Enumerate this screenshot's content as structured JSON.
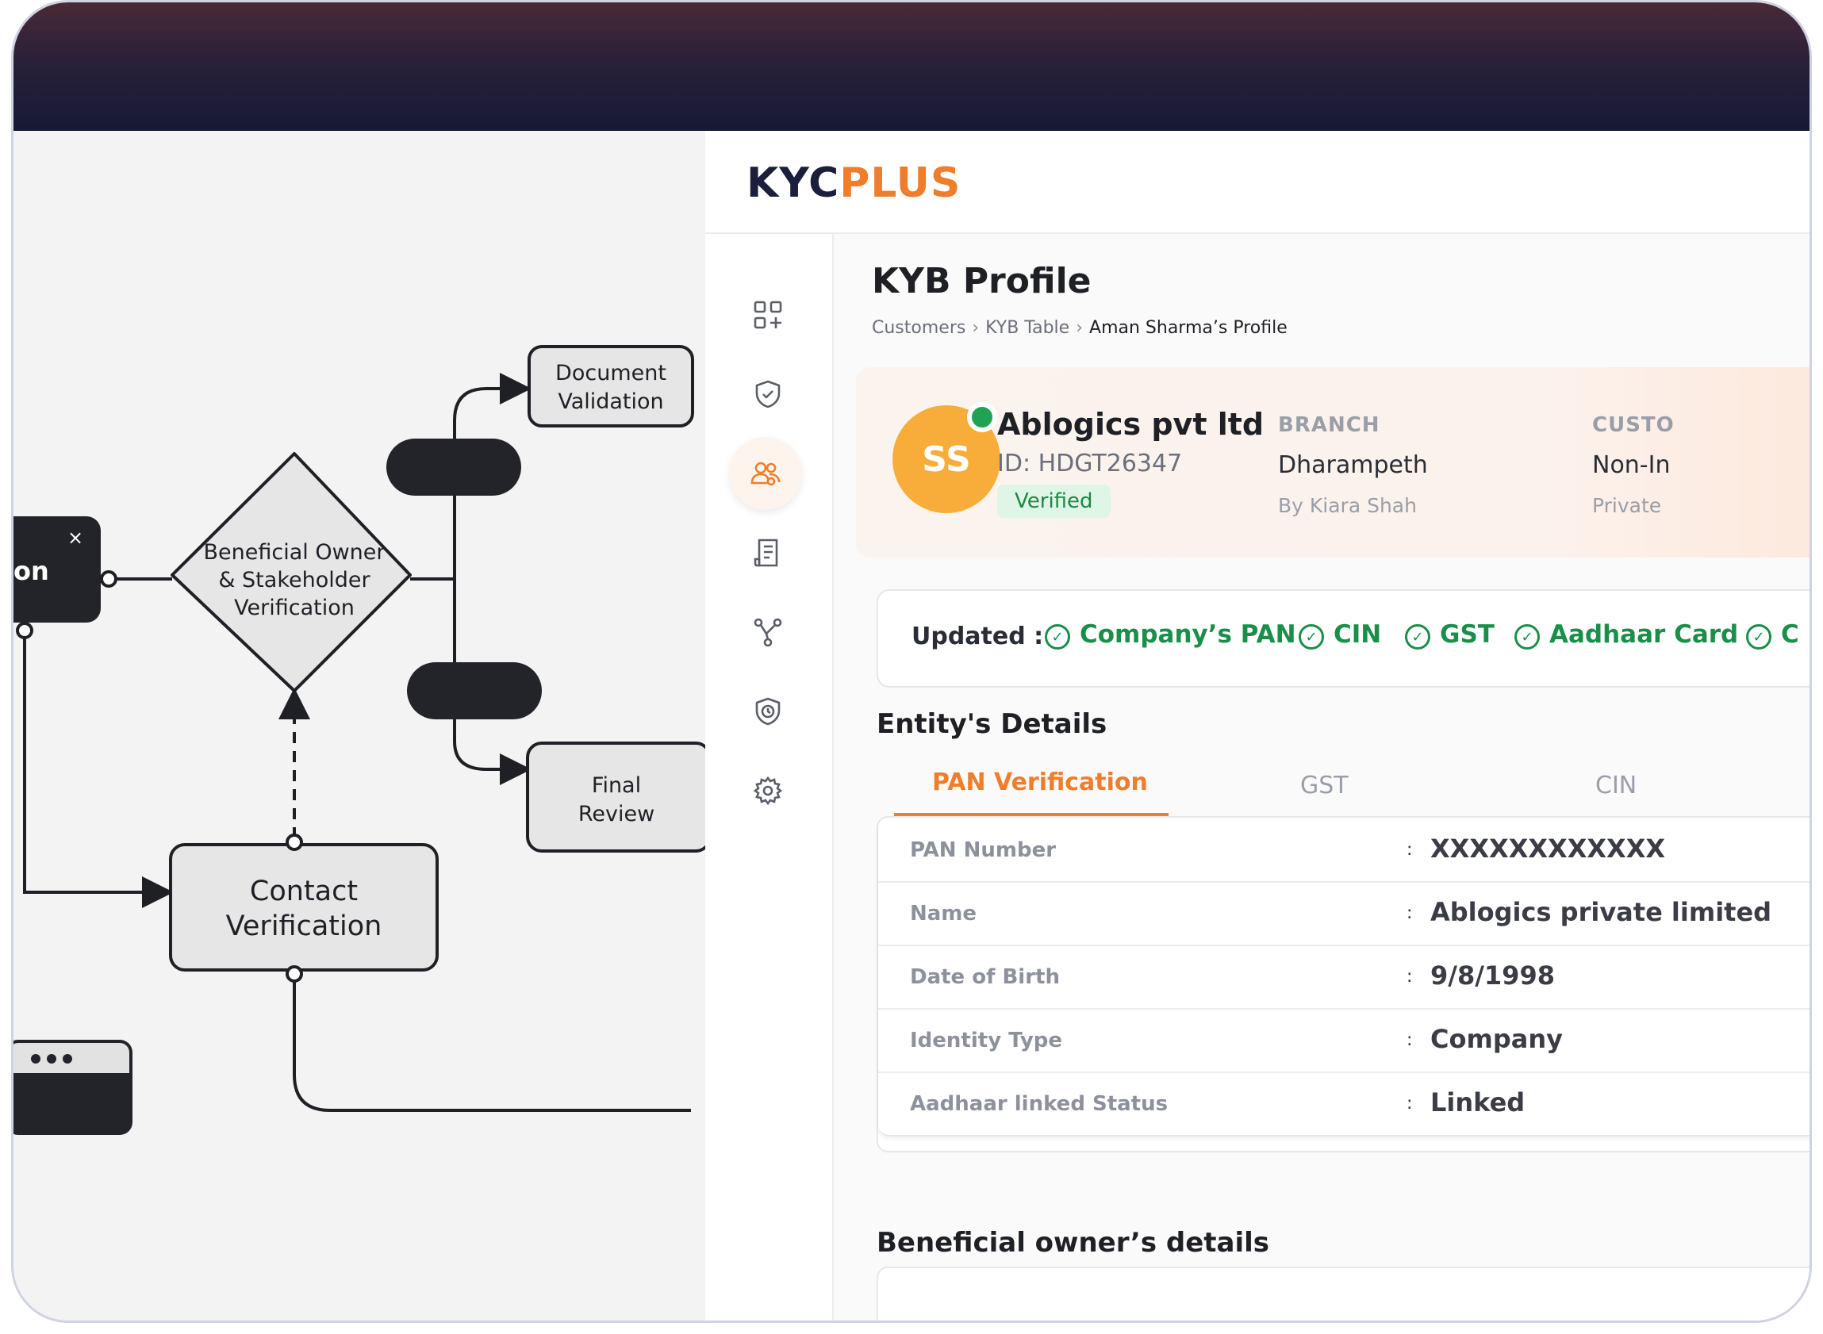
{
  "flowchart": {
    "nodes": {
      "document_validation": [
        "Document",
        "Validation"
      ],
      "beneficial_owner": [
        "Beneficial Owner",
        "& Stakeholder",
        "Verification"
      ],
      "final_review": [
        "Final",
        "Review"
      ],
      "contact_verification": [
        "Contact",
        "Verification"
      ],
      "partial_node": "on",
      "close_glyph": "×"
    }
  },
  "app": {
    "logo": {
      "part1": "KYC",
      "part2": "PLUS",
      "plus_color": "#f07d2c"
    },
    "sidebar": {
      "items": [
        {
          "icon": "dashboard-add-icon"
        },
        {
          "icon": "shield-check-icon"
        },
        {
          "icon": "users-icon",
          "active": true
        },
        {
          "icon": "document-list-icon"
        },
        {
          "icon": "network-icon"
        },
        {
          "icon": "shield-clock-icon"
        },
        {
          "icon": "gear-icon"
        }
      ]
    },
    "page": {
      "title": "KYB Profile",
      "breadcrumb": [
        "Customers",
        "KYB Table",
        "Aman Sharma’s Profile"
      ]
    },
    "profile": {
      "initials": "SS",
      "company_name": "Ablogics pvt ltd",
      "id_text": "ID: HDGT26347",
      "status": "Verified",
      "branch_label": "BRANCH",
      "branch_value": "Dharampeth",
      "branch_sub": "By Kiara Shah",
      "customer_label": "CUSTO",
      "customer_value": "Non-In",
      "customer_sub": "Private"
    },
    "updated": {
      "label": "Updated :",
      "items": [
        "Company’s PAN",
        "CIN",
        "GST",
        "Aadhaar Card",
        "C"
      ]
    },
    "entity_title": "Entity's Details",
    "tabs": [
      "PAN Verification",
      "GST",
      "CIN"
    ],
    "pan_rows": [
      {
        "key": "PAN Number",
        "value": "XXXXXXXXXXXX"
      },
      {
        "key": "Name",
        "value": "Ablogics private limited"
      },
      {
        "key": "Date of Birth",
        "value": "9/8/1998"
      },
      {
        "key": "Identity Type",
        "value": "Company"
      },
      {
        "key": "Aadhaar linked Status",
        "value": "Linked"
      }
    ],
    "beneficial_title": "Beneficial owner’s details",
    "colors": {
      "accent": "#f07d2c",
      "success": "#1a8f4a",
      "avatar": "#f8ad3b"
    }
  }
}
